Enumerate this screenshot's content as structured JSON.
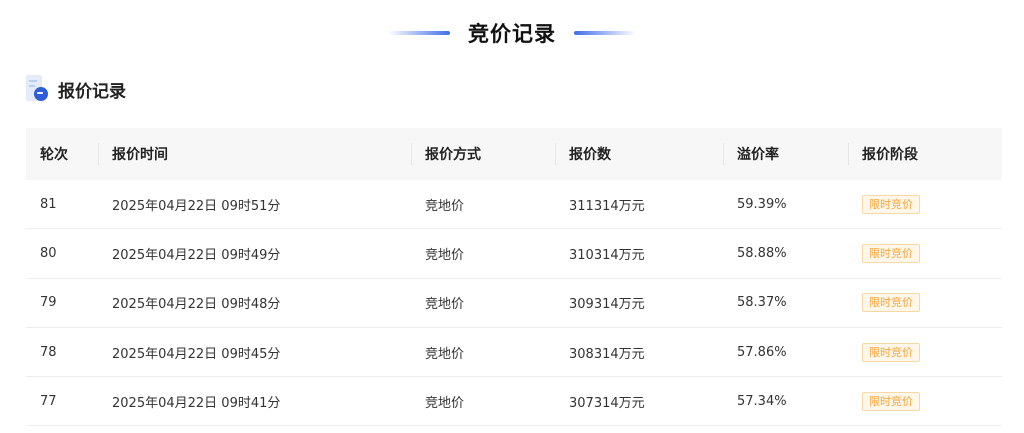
{
  "header": {
    "title": "竞价记录"
  },
  "section": {
    "title": "报价记录"
  },
  "table": {
    "columns": [
      "轮次",
      "报价时间",
      "报价方式",
      "报价数",
      "溢价率",
      "报价阶段"
    ],
    "rows": [
      {
        "round": "81",
        "time": "2025年04月22日 09时51分",
        "method": "竞地价",
        "amount": "311314万元",
        "rate": "59.39%",
        "stage": "限时竞价"
      },
      {
        "round": "80",
        "time": "2025年04月22日 09时49分",
        "method": "竞地价",
        "amount": "310314万元",
        "rate": "58.88%",
        "stage": "限时竞价"
      },
      {
        "round": "79",
        "time": "2025年04月22日 09时48分",
        "method": "竞地价",
        "amount": "309314万元",
        "rate": "58.37%",
        "stage": "限时竞价"
      },
      {
        "round": "78",
        "time": "2025年04月22日 09时45分",
        "method": "竞地价",
        "amount": "308314万元",
        "rate": "57.86%",
        "stage": "限时竞价"
      },
      {
        "round": "77",
        "time": "2025年04月22日 09时41分",
        "method": "竞地价",
        "amount": "307314万元",
        "rate": "57.34%",
        "stage": "限时竞价"
      }
    ]
  },
  "colors": {
    "accent": "#3f6ee8",
    "badge_text": "#f3a43b",
    "badge_bg": "#fff8ea",
    "badge_border": "#f9d9a3"
  },
  "icons": {
    "section_icon": "document-icon",
    "title_decoration": "gradient-line"
  }
}
